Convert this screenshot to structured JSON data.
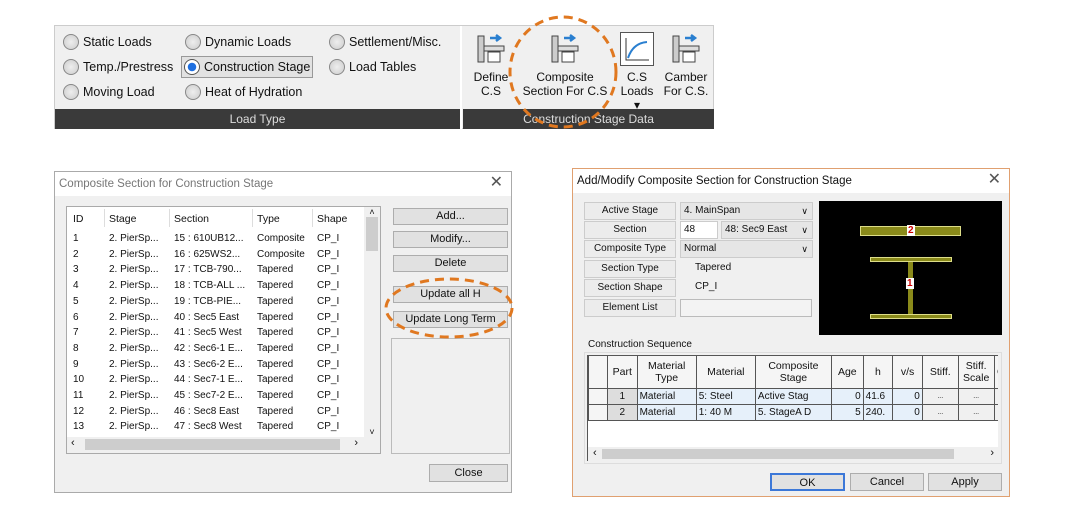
{
  "ribbon": {
    "load_type": {
      "label": "Load Type",
      "options": [
        {
          "label": "Static Loads",
          "selected": false
        },
        {
          "label": "Dynamic Loads",
          "selected": false
        },
        {
          "label": "Settlement/Misc.",
          "selected": false
        },
        {
          "label": "Temp./Prestress",
          "selected": false
        },
        {
          "label": "Construction Stage",
          "selected": true
        },
        {
          "label": "Load Tables",
          "selected": false
        },
        {
          "label": "Moving Load",
          "selected": false
        },
        {
          "label": "Heat of Hydration",
          "selected": false
        }
      ]
    },
    "cs_data": {
      "label": "Construction Stage Data",
      "buttons": [
        {
          "line1": "Define",
          "line2": "C.S",
          "icon": "define-cs-icon"
        },
        {
          "line1": "Composite",
          "line2": "Section For C.S",
          "icon": "composite-section-icon"
        },
        {
          "line1": "C.S",
          "line2": "Loads ▾",
          "icon": "cs-loads-chart-icon"
        },
        {
          "line1": "Camber",
          "line2": "For C.S.",
          "icon": "camber-icon"
        }
      ]
    }
  },
  "dialog1": {
    "title": "Composite Section for Construction Stage",
    "columns": [
      "ID",
      "Stage",
      "Section",
      "Type",
      "Shape"
    ],
    "rows": [
      [
        "1",
        "2. PierSp...",
        "15 : 610UB12...",
        "Composite",
        "CP_I"
      ],
      [
        "2",
        "2. PierSp...",
        "16 : 625WS2...",
        "Composite",
        "CP_I"
      ],
      [
        "3",
        "2. PierSp...",
        "17 : TCB-790...",
        "Tapered",
        "CP_I"
      ],
      [
        "4",
        "2. PierSp...",
        "18 : TCB-ALL ...",
        "Tapered",
        "CP_I"
      ],
      [
        "5",
        "2. PierSp...",
        "19 : TCB-PIE...",
        "Tapered",
        "CP_I"
      ],
      [
        "6",
        "2. PierSp...",
        "40 : Sec5 East",
        "Tapered",
        "CP_I"
      ],
      [
        "7",
        "2. PierSp...",
        "41 : Sec5 West",
        "Tapered",
        "CP_I"
      ],
      [
        "8",
        "2. PierSp...",
        "42 : Sec6-1 E...",
        "Tapered",
        "CP_I"
      ],
      [
        "9",
        "2. PierSp...",
        "43 : Sec6-2 E...",
        "Tapered",
        "CP_I"
      ],
      [
        "10",
        "2. PierSp...",
        "44 : Sec7-1 E...",
        "Tapered",
        "CP_I"
      ],
      [
        "11",
        "2. PierSp...",
        "45 : Sec7-2 E...",
        "Tapered",
        "CP_I"
      ],
      [
        "12",
        "2. PierSp...",
        "46 : Sec8 East",
        "Tapered",
        "CP_I"
      ],
      [
        "13",
        "2. PierSp...",
        "47 : Sec8 West",
        "Tapered",
        "CP_I"
      ]
    ],
    "buttons": {
      "add": "Add...",
      "modify": "Modify...",
      "delete": "Delete",
      "update_h": "Update all H",
      "update_long": "Update Long Term",
      "close": "Close"
    }
  },
  "dialog2": {
    "title": "Add/Modify Composite Section for Construction Stage",
    "labels": {
      "active_stage": "Active Stage",
      "section": "Section",
      "composite_type": "Composite Type",
      "section_type": "Section Type",
      "section_shape": "Section Shape",
      "element_list": "Element List"
    },
    "values": {
      "active_stage": "4. MainSpan",
      "section_id": "48",
      "section": "48: Sec9 East",
      "composite_type": "Normal",
      "section_type": "Tapered",
      "section_shape": "CP_I",
      "element_list": ""
    },
    "preview": {
      "part_labels": [
        "2",
        "1"
      ],
      "colors": {
        "bg": "#000000",
        "part": "#8a8a1a"
      }
    },
    "sequence_label": "Construction Sequence",
    "columns": [
      "Part",
      "Material Type",
      "Material",
      "Composite Stage",
      "Age",
      "h",
      "v/s",
      "Stiff.",
      "Stiff. Scale",
      "C"
    ],
    "rows": [
      [
        "1",
        "Material",
        "5: Steel",
        "Active Stag",
        "0",
        "41.6",
        "0",
        "...",
        "..."
      ],
      [
        "2",
        "Material",
        "1: 40 M",
        "5. StageA D",
        "5",
        "240.",
        "0",
        "...",
        "..."
      ]
    ],
    "buttons": {
      "ok": "OK",
      "cancel": "Cancel",
      "apply": "Apply"
    }
  },
  "highlight_color": "#e07820"
}
